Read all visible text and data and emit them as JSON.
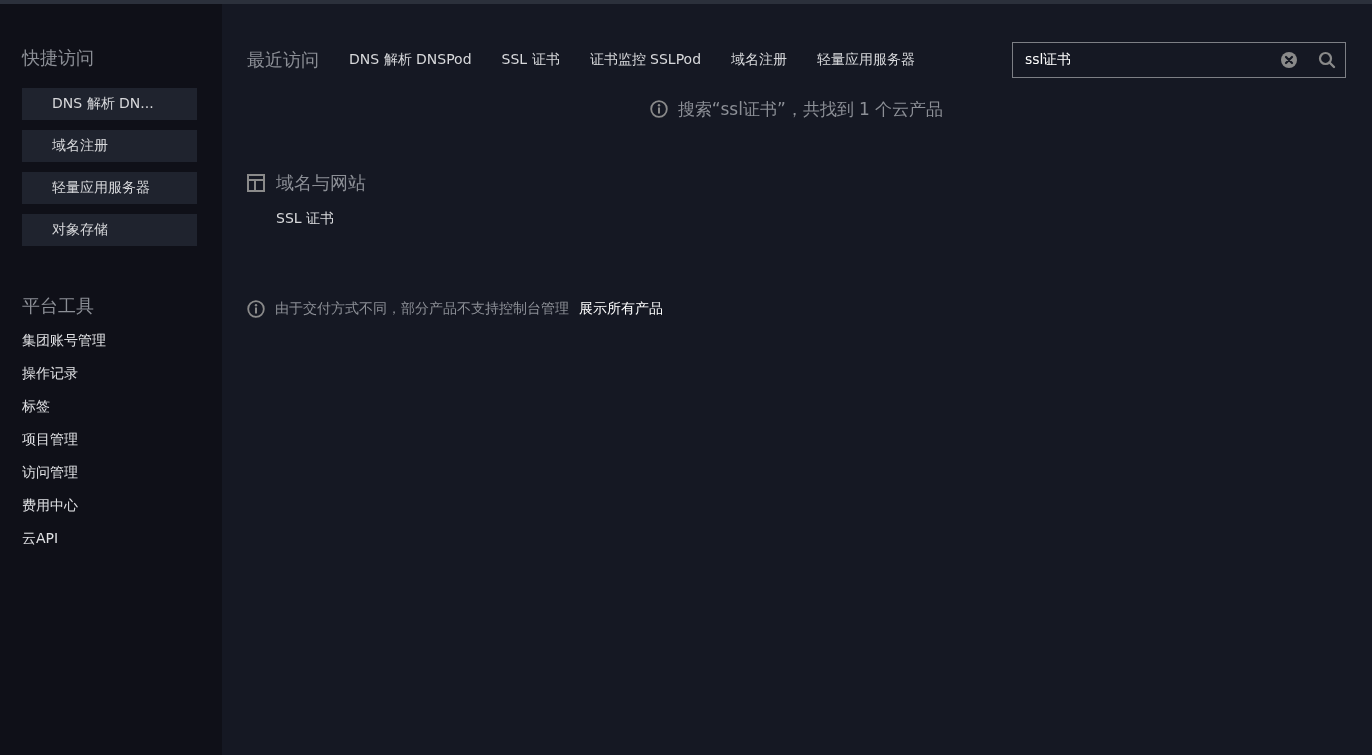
{
  "sidebar": {
    "quick_access": {
      "title": "快捷访问",
      "items": [
        "DNS 解析 DN...",
        "域名注册",
        "轻量应用服务器",
        "对象存储"
      ]
    },
    "platform_tools": {
      "title": "平台工具",
      "items": [
        "集团账号管理",
        "操作记录",
        "标签",
        "项目管理",
        "访问管理",
        "费用中心",
        "云API"
      ]
    }
  },
  "recent": {
    "title": "最近访问",
    "items": [
      "DNS 解析 DNSPod",
      "SSL 证书",
      "证书监控 SSLPod",
      "域名注册",
      "轻量应用服务器"
    ]
  },
  "search": {
    "value": "ssl证书"
  },
  "result_message": "搜索“ssl证书”，共找到 1 个云产品",
  "categories": [
    {
      "title": "域名与网站",
      "products": [
        "SSL 证书"
      ]
    }
  ],
  "notice": {
    "text": "由于交付方式不同，部分产品不支持控制台管理",
    "link": "展示所有产品"
  }
}
